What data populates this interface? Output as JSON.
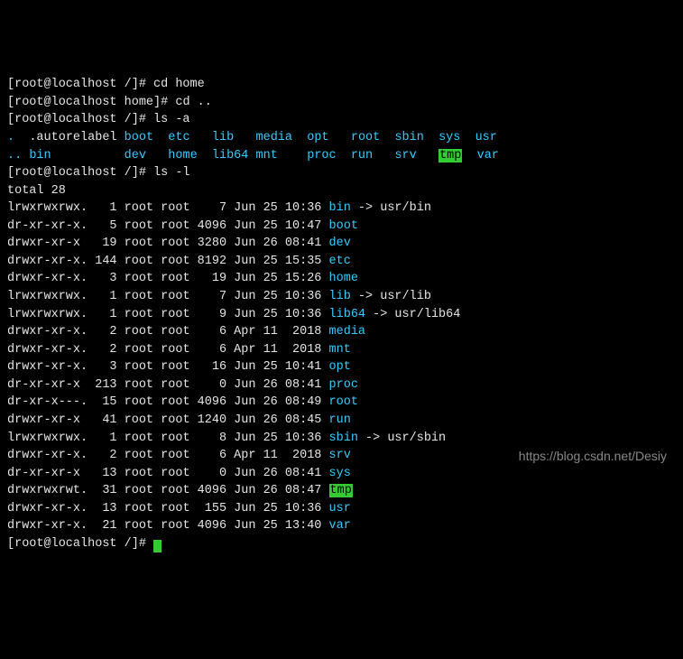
{
  "prompt_root": "[root@localhost /]#",
  "prompt_home": "[root@localhost home]#",
  "cmds": {
    "cd_home": "cd home",
    "cd_up": "cd ..",
    "ls_a": "ls -a",
    "ls_l": "ls -l"
  },
  "ls_a_rows": [
    [
      {
        "t": ".",
        "c": "cyan"
      },
      {
        "t": ".autorelabel",
        "c": "white"
      },
      {
        "t": "boot",
        "c": "cyan"
      },
      {
        "t": "etc",
        "c": "cyan"
      },
      {
        "t": "lib",
        "c": "cyan"
      },
      {
        "t": "media",
        "c": "cyan"
      },
      {
        "t": "opt",
        "c": "cyan"
      },
      {
        "t": "root",
        "c": "cyan"
      },
      {
        "t": "sbin",
        "c": "cyan"
      },
      {
        "t": "sys",
        "c": "cyan"
      },
      {
        "t": "usr",
        "c": "cyan"
      }
    ],
    [
      {
        "t": "..",
        "c": "cyan"
      },
      {
        "t": "bin",
        "c": "cyan"
      },
      {
        "t": "dev",
        "c": "cyan"
      },
      {
        "t": "home",
        "c": "cyan"
      },
      {
        "t": "lib64",
        "c": "cyan"
      },
      {
        "t": "mnt",
        "c": "cyan"
      },
      {
        "t": "proc",
        "c": "cyan"
      },
      {
        "t": "run",
        "c": "cyan"
      },
      {
        "t": "srv",
        "c": "cyan"
      },
      {
        "t": "tmp",
        "c": "tmpbg"
      },
      {
        "t": "var",
        "c": "cyan"
      }
    ]
  ],
  "ls_a_cols": [
    0,
    3,
    16,
    22,
    28,
    34,
    41,
    47,
    53,
    59,
    64
  ],
  "total_line": "total 28",
  "ls_l": [
    {
      "perm": "lrwxrwxrwx.",
      "n": "1",
      "o": "root",
      "g": "root",
      "s": "7",
      "d": "Jun 25 10:36",
      "name": "bin",
      "nc": "cyan",
      "link": " -> usr/bin"
    },
    {
      "perm": "dr-xr-xr-x.",
      "n": "5",
      "o": "root",
      "g": "root",
      "s": "4096",
      "d": "Jun 25 10:47",
      "name": "boot",
      "nc": "cyan"
    },
    {
      "perm": "drwxr-xr-x",
      "n": "19",
      "o": "root",
      "g": "root",
      "s": "3280",
      "d": "Jun 26 08:41",
      "name": "dev",
      "nc": "cyan"
    },
    {
      "perm": "drwxr-xr-x.",
      "n": "144",
      "o": "root",
      "g": "root",
      "s": "8192",
      "d": "Jun 25 15:35",
      "name": "etc",
      "nc": "cyan"
    },
    {
      "perm": "drwxr-xr-x.",
      "n": "3",
      "o": "root",
      "g": "root",
      "s": "19",
      "d": "Jun 25 15:26",
      "name": "home",
      "nc": "cyan"
    },
    {
      "perm": "lrwxrwxrwx.",
      "n": "1",
      "o": "root",
      "g": "root",
      "s": "7",
      "d": "Jun 25 10:36",
      "name": "lib",
      "nc": "cyan",
      "link": " -> usr/lib"
    },
    {
      "perm": "lrwxrwxrwx.",
      "n": "1",
      "o": "root",
      "g": "root",
      "s": "9",
      "d": "Jun 25 10:36",
      "name": "lib64",
      "nc": "cyan",
      "link": " -> usr/lib64"
    },
    {
      "perm": "drwxr-xr-x.",
      "n": "2",
      "o": "root",
      "g": "root",
      "s": "6",
      "d": "Apr 11  2018",
      "name": "media",
      "nc": "cyan"
    },
    {
      "perm": "drwxr-xr-x.",
      "n": "2",
      "o": "root",
      "g": "root",
      "s": "6",
      "d": "Apr 11  2018",
      "name": "mnt",
      "nc": "cyan"
    },
    {
      "perm": "drwxr-xr-x.",
      "n": "3",
      "o": "root",
      "g": "root",
      "s": "16",
      "d": "Jun 25 10:41",
      "name": "opt",
      "nc": "cyan"
    },
    {
      "perm": "dr-xr-xr-x",
      "n": "213",
      "o": "root",
      "g": "root",
      "s": "0",
      "d": "Jun 26 08:41",
      "name": "proc",
      "nc": "cyan"
    },
    {
      "perm": "dr-xr-x---.",
      "n": "15",
      "o": "root",
      "g": "root",
      "s": "4096",
      "d": "Jun 26 08:49",
      "name": "root",
      "nc": "cyan"
    },
    {
      "perm": "drwxr-xr-x",
      "n": "41",
      "o": "root",
      "g": "root",
      "s": "1240",
      "d": "Jun 26 08:45",
      "name": "run",
      "nc": "cyan"
    },
    {
      "perm": "lrwxrwxrwx.",
      "n": "1",
      "o": "root",
      "g": "root",
      "s": "8",
      "d": "Jun 25 10:36",
      "name": "sbin",
      "nc": "cyan",
      "link": " -> usr/sbin"
    },
    {
      "perm": "drwxr-xr-x.",
      "n": "2",
      "o": "root",
      "g": "root",
      "s": "6",
      "d": "Apr 11  2018",
      "name": "srv",
      "nc": "cyan"
    },
    {
      "perm": "dr-xr-xr-x",
      "n": "13",
      "o": "root",
      "g": "root",
      "s": "0",
      "d": "Jun 26 08:41",
      "name": "sys",
      "nc": "cyan"
    },
    {
      "perm": "drwxrwxrwt.",
      "n": "31",
      "o": "root",
      "g": "root",
      "s": "4096",
      "d": "Jun 26 08:47",
      "name": "tmp",
      "nc": "tmpbg"
    },
    {
      "perm": "drwxr-xr-x.",
      "n": "13",
      "o": "root",
      "g": "root",
      "s": "155",
      "d": "Jun 25 10:36",
      "name": "usr",
      "nc": "cyan"
    },
    {
      "perm": "drwxr-xr-x.",
      "n": "21",
      "o": "root",
      "g": "root",
      "s": "4096",
      "d": "Jun 25 13:40",
      "name": "var",
      "nc": "cyan"
    }
  ],
  "watermark": "https://blog.csdn.net/Desiy"
}
